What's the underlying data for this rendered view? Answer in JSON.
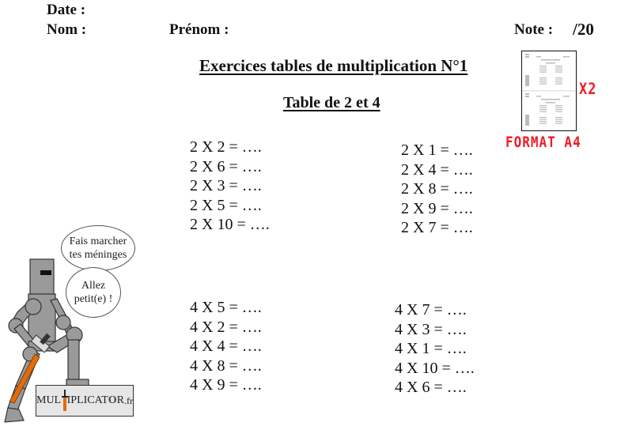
{
  "header": {
    "date_label": "Date :",
    "nom_label": "Nom :",
    "prenom_label": "Prénom :",
    "note_label": "Note :",
    "note_total": "/20"
  },
  "title": "Exercices tables de multiplication N°1",
  "subtitle": "Table de 2 et 4",
  "promo": {
    "copies": "X2",
    "format": "FORMAT A4",
    "accent_color": "#ee1c24"
  },
  "exercises": {
    "table2_left": [
      "2 X 2 = ….",
      "2 X 6 = ….",
      "2 X 3 = ….",
      "2 X 5 = ….",
      "2 X 10 = …."
    ],
    "table2_right": [
      "2 X 1 = ….",
      "2 X 4 = ….",
      "2 X 8 = ….",
      "2 X 9 = ….",
      "2 X 7 = …."
    ],
    "table4_left": [
      "4 X 5 = ….",
      "4 X 2 = ….",
      "4 X 4 = ….",
      "4 X 8 = ….",
      "4 X 9 = …."
    ],
    "table4_right": [
      "4 X 7 = ….",
      "4 X 3 = ….",
      "4 X 1 = ….",
      "4 X 10 = ….",
      "4 X 6 = …."
    ]
  },
  "mascot": {
    "bubble1_line1": "Fais marcher",
    "bubble1_line2": "tes méninges",
    "bubble2_line1": "Allez",
    "bubble2_line2": "petit(e) !",
    "logo_left": "MUL",
    "logo_right": "IPLICAT",
    "logo_o": "O",
    "logo_end": "R",
    "logo_tld": ".fr"
  }
}
